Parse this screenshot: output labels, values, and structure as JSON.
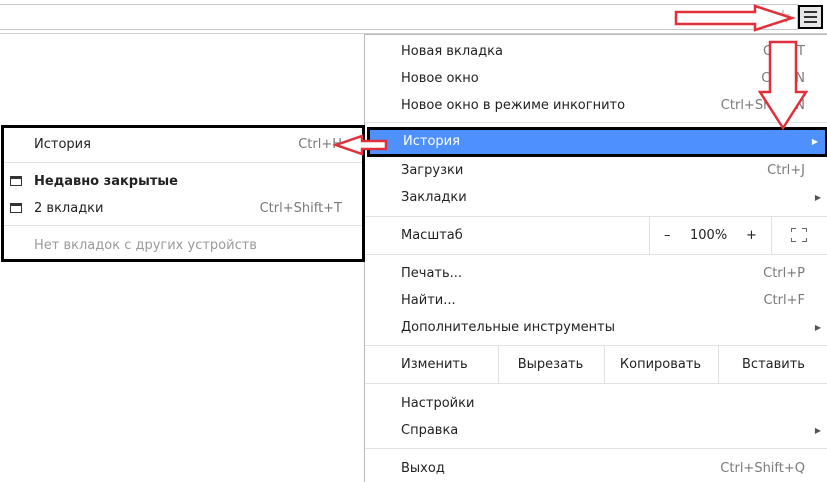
{
  "toolbar": {
    "star_icon": "star-icon",
    "menu_icon": "hamburger-menu-icon"
  },
  "menu": {
    "new_tab": {
      "label": "Новая вкладка",
      "shortcut": "Ctrl+T"
    },
    "new_window": {
      "label": "Новое окно",
      "shortcut": "Ctrl+N"
    },
    "incognito": {
      "label": "Новое окно в режиме инкогнито",
      "shortcut": "Ctrl+Shift+N"
    },
    "history": {
      "label": "История"
    },
    "downloads": {
      "label": "Загрузки",
      "shortcut": "Ctrl+J"
    },
    "bookmarks": {
      "label": "Закладки"
    },
    "zoom": {
      "label": "Масштаб",
      "minus": "–",
      "value": "100%",
      "plus": "+"
    },
    "print": {
      "label": "Печать...",
      "shortcut": "Ctrl+P"
    },
    "find": {
      "label": "Найти...",
      "shortcut": "Ctrl+F"
    },
    "more_tools": {
      "label": "Дополнительные инструменты"
    },
    "edit": {
      "label": "Изменить",
      "cut": "Вырезать",
      "copy": "Копировать",
      "paste": "Вставить"
    },
    "settings": {
      "label": "Настройки"
    },
    "help": {
      "label": "Справка"
    },
    "exit": {
      "label": "Выход",
      "shortcut": "Ctrl+Shift+Q"
    }
  },
  "history_submenu": {
    "history": {
      "label": "История",
      "shortcut": "Ctrl+H"
    },
    "recently_closed": {
      "label": "Недавно закрытые"
    },
    "tabs": {
      "label": "2 вкладки",
      "shortcut": "Ctrl+Shift+T"
    },
    "no_other_devices": {
      "label": "Нет вкладок с других устройств"
    }
  },
  "colors": {
    "highlight": "#4d90fe",
    "annotation_arrow": "#e0303a"
  }
}
